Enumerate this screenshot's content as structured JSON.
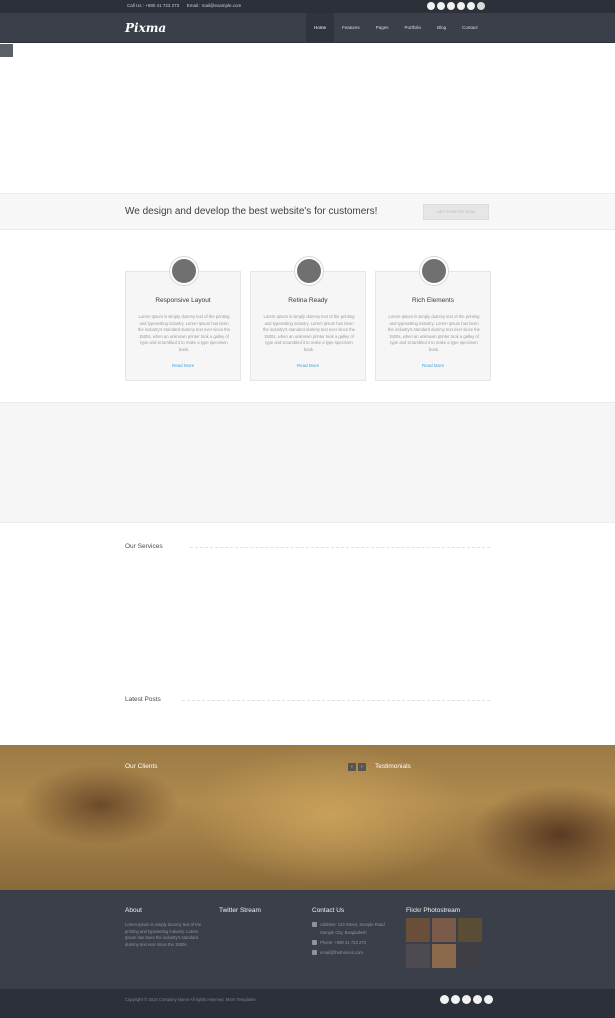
{
  "topbar": {
    "phone": "Call Us : +880 41 723 273",
    "email": "Email : mail@example.com",
    "social_icons": [
      "facebook-icon",
      "twitter-icon",
      "linkedin-icon",
      "dribbble-icon",
      "google-plus-icon",
      "rss-icon"
    ]
  },
  "header": {
    "logo": "Pixma",
    "nav": [
      "Home",
      "Features",
      "Pages",
      "Portfolio",
      "Blog",
      "Contact"
    ],
    "active_nav": "Home"
  },
  "cta": {
    "headline": "We design and develop the best website's for customers!",
    "button": "GET STARTED NOW"
  },
  "features": [
    {
      "title": "Responsive Layout",
      "body": "Lorem Ipsum is simply dummy text of the printing and typesetting industry. Lorem Ipsum has been the industry's standard dummy text ever since the 1500s, when an unknown printer took a galley of type and scrambled it to make a type specimen book.",
      "link": "Read More"
    },
    {
      "title": "Retina Ready",
      "body": "Lorem Ipsum is simply dummy text of the printing and typesetting industry. Lorem Ipsum has been the industry's standard dummy text ever since the 1500s, when an unknown printer took a galley of type and scrambled it to make a type specimen book.",
      "link": "Read More"
    },
    {
      "title": "Rich Elements",
      "body": "Lorem Ipsum is simply dummy text of the printing and typesetting industry. Lorem Ipsum has been the industry's standard dummy text ever since the 1500s, when an unknown printer took a galley of type and scrambled it to make a type specimen book.",
      "link": "Read More"
    }
  ],
  "sections": {
    "services": "Our Services",
    "latest_posts": "Latest Posts",
    "clients": "Our Clients",
    "testimonials": "Testimonials"
  },
  "footer": {
    "about_title": "About",
    "about_text": "Lorem Ipsum is simply dummy text of the printing and typesetting industry. Lorem Ipsum has been the industry's standard dummy text ever since the 1500s.",
    "twitter_title": "Twitter Stream",
    "contact_title": "Contact Us",
    "contact_address": "Address: 123 Street, Sample Road",
    "contact_city": "Sample City, Bangladesh",
    "contact_phone": "Phone: +880 41 723 273",
    "contact_email": "email@thethemes.com",
    "flickr_title": "Flickr Photostream"
  },
  "bottombar": {
    "copyright": "Copyright © 2014 Company Name All rights reserved.",
    "more": "More Templates"
  },
  "colors": {
    "topbar": "#2c3038",
    "navbar": "#3a3f4a",
    "link": "#4ea3d9"
  }
}
